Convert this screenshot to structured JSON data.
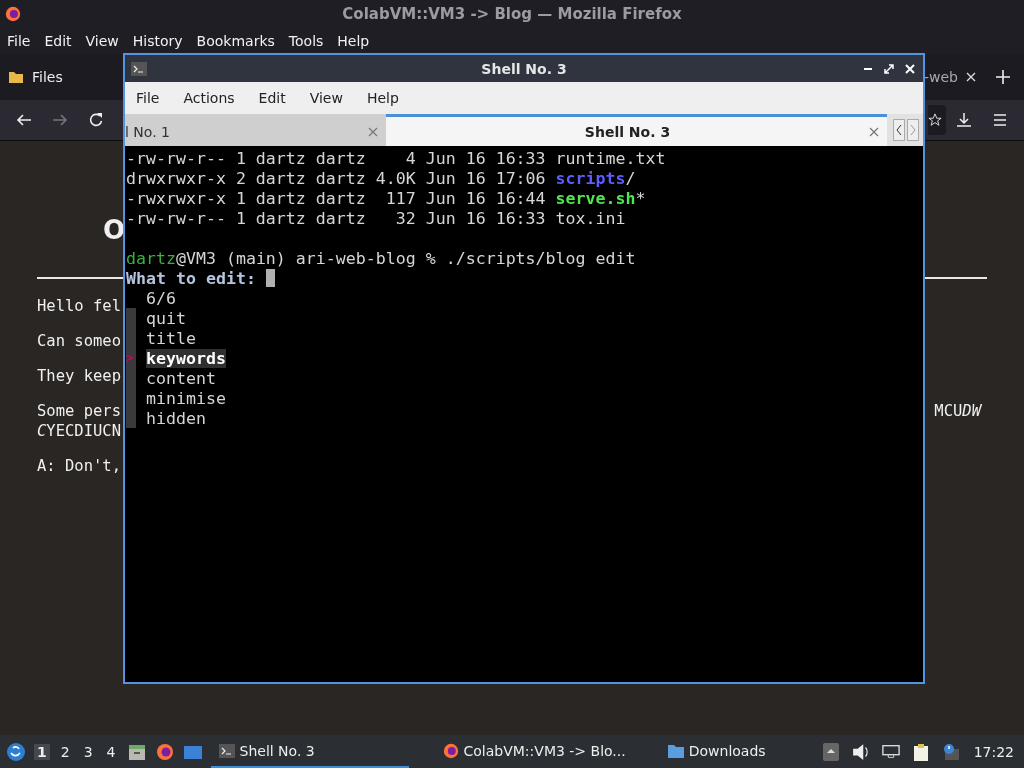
{
  "firefox": {
    "title": "ColabVM::VM3 -> Blog — Mozilla Firefox",
    "menu": [
      "File",
      "Edit",
      "View",
      "History",
      "Bookmarks",
      "Tools",
      "Help"
    ],
    "tabs": [
      {
        "label": "Files",
        "selected": false
      },
      {
        "label": "-web",
        "selected": false
      }
    ],
    "forward_disabled": true,
    "page": {
      "heading": "O",
      "paragraphs": [
        {
          "text": "Hello fel"
        },
        {
          "text": "Can someo"
        },
        {
          "text": "They keep"
        },
        {
          "text": "Some pers",
          "continuation": [
            {
              "text": "C",
              "italic": true
            },
            {
              "text": "YECDIUCN",
              "italic": false
            }
          ],
          "right_fragment": [
            {
              "text": "MCU",
              "italic": false
            },
            {
              "text": "DW",
              "italic": true
            }
          ]
        },
        {
          "text": "A: Don't,"
        }
      ]
    }
  },
  "terminal": {
    "title": "Shell No. 3",
    "menu": [
      "File",
      "Actions",
      "Edit",
      "View",
      "Help"
    ],
    "tabs": [
      {
        "label": "l No. 1",
        "selected": false
      },
      {
        "label": "Shell No. 3",
        "selected": true
      }
    ],
    "lines": [
      {
        "segments": [
          {
            "text": "-rw-rw-r-- 1 dartz dartz    4 Jun 16 16:33 runtime.txt",
            "kind": "plain"
          }
        ]
      },
      {
        "segments": [
          {
            "text": "drwxrwxr-x 2 dartz dartz 4.0K Jun 16 17:06 ",
            "kind": "plain"
          },
          {
            "text": "scripts",
            "kind": "dir"
          },
          {
            "text": "/",
            "kind": "plain"
          }
        ]
      },
      {
        "segments": [
          {
            "text": "-rwxrwxr-x 1 dartz dartz  117 Jun 16 16:44 ",
            "kind": "plain"
          },
          {
            "text": "serve.sh",
            "kind": "exec"
          },
          {
            "text": "*",
            "kind": "plain"
          }
        ]
      },
      {
        "segments": [
          {
            "text": "-rw-rw-r-- 1 dartz dartz   32 Jun 16 16:33 tox.ini",
            "kind": "plain"
          }
        ]
      },
      {
        "gap_before": true,
        "segments": [
          {
            "text": "dartz",
            "kind": "user"
          },
          {
            "text": "@VM3 (main) ari-web-blog % ./scripts/blog edit",
            "kind": "plain"
          }
        ]
      },
      {
        "cursor": true,
        "segments": [
          {
            "text": "What to edit: ",
            "kind": "label"
          }
        ]
      }
    ],
    "picker": {
      "counter": "6/6",
      "pointer": ">",
      "items": [
        {
          "label": "quit",
          "selected": false
        },
        {
          "label": "title",
          "selected": false
        },
        {
          "label": "keywords",
          "selected": true
        },
        {
          "label": "content",
          "selected": false
        },
        {
          "label": "minimise",
          "selected": false
        },
        {
          "label": "hidden",
          "selected": false
        }
      ]
    }
  },
  "taskbar": {
    "workspaces": [
      {
        "label": "1",
        "selected": true
      },
      {
        "label": "2",
        "selected": false
      },
      {
        "label": "3",
        "selected": false
      },
      {
        "label": "4",
        "selected": false
      }
    ],
    "tasks": [
      {
        "label": "Shell No. 3",
        "kind": "terminal",
        "selected": true
      },
      {
        "label": "ColabVM::VM3 -> Blo...",
        "kind": "browser",
        "selected": false
      },
      {
        "label": "Downloads",
        "kind": "folder",
        "selected": false
      }
    ],
    "clock": "17:22"
  }
}
